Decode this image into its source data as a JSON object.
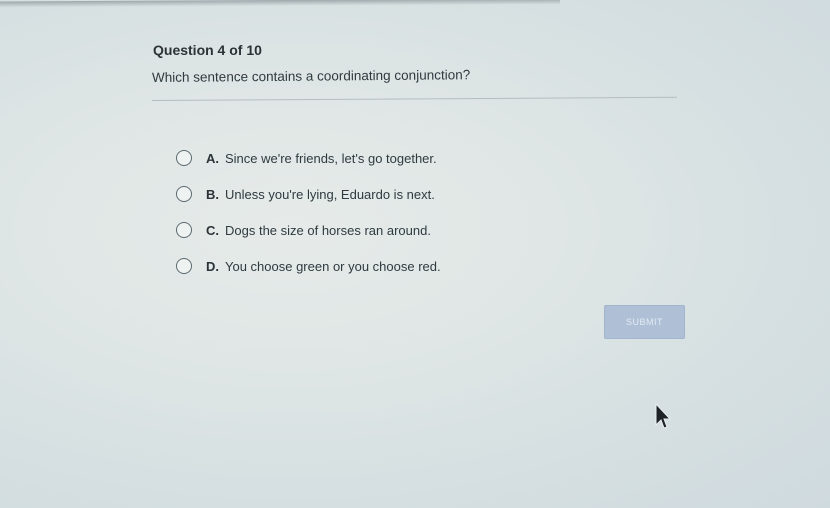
{
  "quiz": {
    "header": "Question 4 of 10",
    "prompt": "Which sentence contains a coordinating conjunction?",
    "options": [
      {
        "letter": "A.",
        "text": "Since we're friends, let's go together."
      },
      {
        "letter": "B.",
        "text": "Unless you're lying, Eduardo is next."
      },
      {
        "letter": "C.",
        "text": "Dogs the size of horses ran around."
      },
      {
        "letter": "D.",
        "text": "You choose green or you choose red."
      }
    ],
    "submit_label": "SUBMIT"
  },
  "icons": {
    "radio": "radio-button-icon",
    "cursor": "mouse-pointer-icon"
  },
  "colors": {
    "submit_bg": "#aebfd6",
    "background": "#dfe6e5",
    "text": "#2f3a40"
  }
}
